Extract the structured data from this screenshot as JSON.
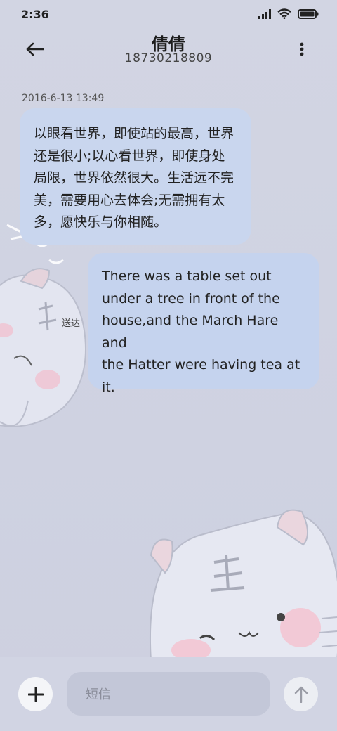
{
  "status_bar": {
    "time": "2:36",
    "icons": [
      "signal-icon",
      "wifi-icon",
      "battery-icon"
    ]
  },
  "header": {
    "back_icon": "arrow-left-icon",
    "contact_name": "倩倩",
    "contact_number": "18730218809",
    "more_icon": "more-vertical-icon"
  },
  "conversation": {
    "timestamp": "2016-6-13 13:49",
    "messages": [
      {
        "direction": "incoming",
        "lines": [
          "以眼看世界，即使站的最高，世界",
          "还是很小;以心看世界，即使身处",
          "局限，世界依然很大。生活远不完",
          "美，需要用心去体会;无需拥有太",
          "多，愿快乐与你相随。"
        ]
      },
      {
        "direction": "outgoing",
        "lines": [
          "There was a table set out",
          "under a tree in front of the",
          "house,and the March Hare and",
          "the Hatter were having tea at",
          "it."
        ],
        "status": "送达"
      }
    ]
  },
  "composer": {
    "add_icon": "plus-icon",
    "placeholder": "短信",
    "send_icon": "arrow-up-icon"
  },
  "colors": {
    "background": "#d1d4e3",
    "bubble": "#c9d6ee"
  }
}
